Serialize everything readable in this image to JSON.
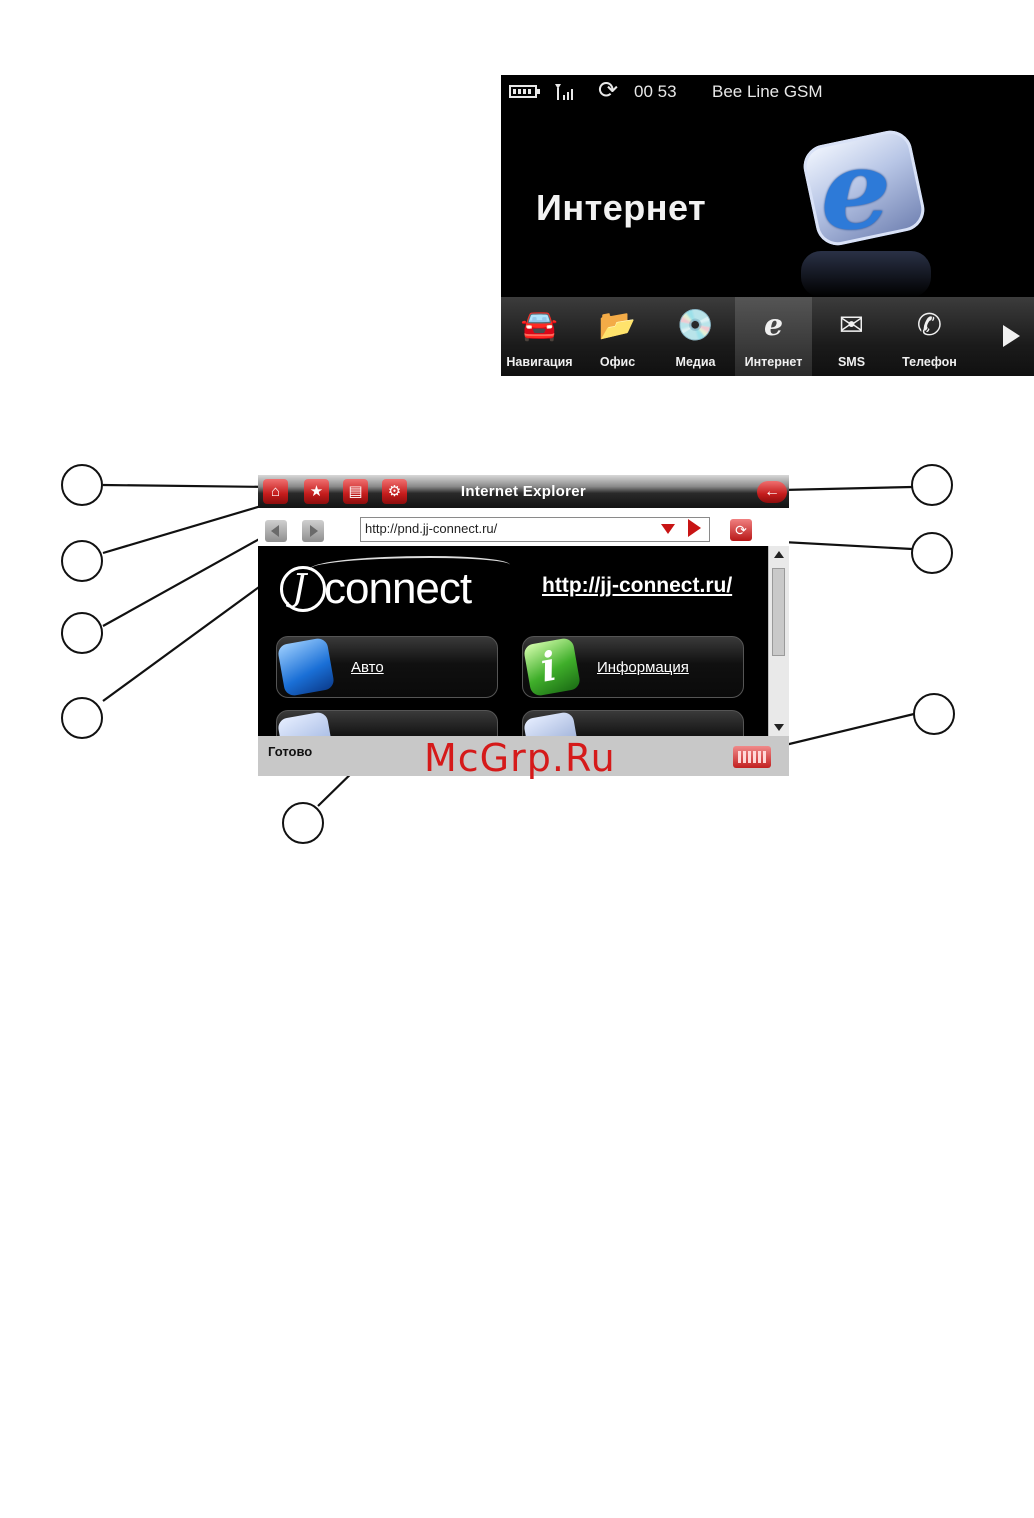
{
  "home_screen": {
    "status": {
      "clock": "00 53",
      "carrier": "Bee Line GSM"
    },
    "title": "Интернет",
    "dock": [
      {
        "label": "Навигация",
        "icon": "car-icon"
      },
      {
        "label": "Офис",
        "icon": "folder-icon"
      },
      {
        "label": "Медиа",
        "icon": "disc-icon"
      },
      {
        "label": "Интернет",
        "icon": "internet-explorer-icon",
        "active": true
      },
      {
        "label": "SMS",
        "icon": "envelope-icon"
      },
      {
        "label": "Телефон",
        "icon": "phone-icon"
      }
    ]
  },
  "browser": {
    "title": "Internet Explorer",
    "address": "http://pnd.jj-connect.ru/",
    "content": {
      "logo_text": "connect",
      "site_link": "http://jj-connect.ru/",
      "buttons": [
        {
          "label": "Авто",
          "icon": "car-tile-icon"
        },
        {
          "label": "Информация",
          "icon": "info-tile-icon"
        }
      ]
    },
    "status": "Готово"
  },
  "watermark": "McGrp.Ru",
  "colors": {
    "accent_red": "#c81414",
    "background": "#000000"
  }
}
